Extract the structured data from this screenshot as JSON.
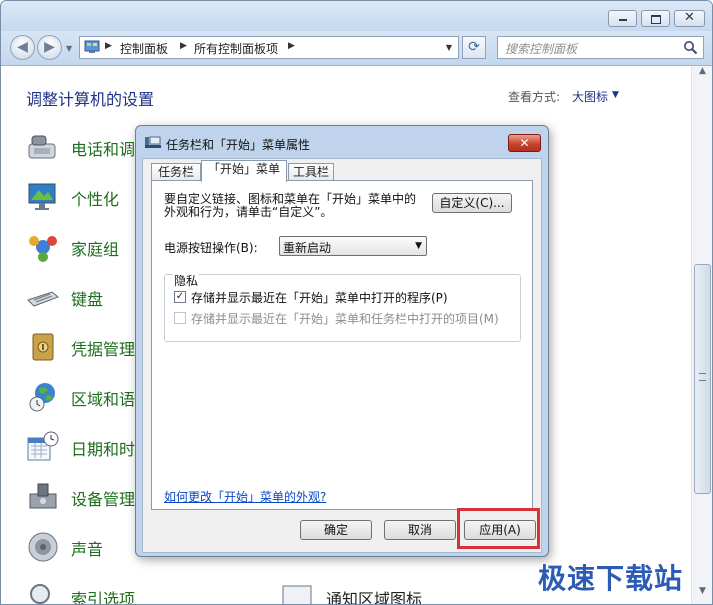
{
  "window": {
    "caption_buttons": {
      "minimize": "",
      "maximize": "",
      "close": "✕"
    }
  },
  "address_bar": {
    "crumbs": [
      "控制面板",
      "所有控制面板项"
    ],
    "search_placeholder": "搜索控制面板"
  },
  "content": {
    "title": "调整计算机的设置",
    "view_by_label": "查看方式:",
    "view_by_value": "大图标",
    "items": [
      {
        "label": "电话和调",
        "icon": "phone-modem-icon"
      },
      {
        "label": "个性化",
        "icon": "personalization-icon"
      },
      {
        "label": "家庭组",
        "icon": "homegroup-icon"
      },
      {
        "label": "键盘",
        "icon": "keyboard-icon"
      },
      {
        "label": "凭据管理",
        "icon": "credential-manager-icon"
      },
      {
        "label": "区域和语",
        "icon": "region-globe-icon"
      },
      {
        "label": "日期和时",
        "icon": "calendar-clock-icon"
      },
      {
        "label": "设备管理",
        "icon": "device-manager-icon"
      },
      {
        "label": "声音",
        "icon": "speaker-icon"
      },
      {
        "label": "索引选项",
        "icon": "indexing-icon"
      }
    ],
    "right_column_partial": {
      "label": "通知区域图标"
    }
  },
  "dialog": {
    "title": "任务栏和「开始」菜单属性",
    "close_label": "✕",
    "tabs": [
      "任务栏",
      "「开始」菜单",
      "工具栏"
    ],
    "active_tab": 1,
    "description_line1": "要自定义链接、图标和菜单在「开始」菜单中的",
    "description_line2": "外观和行为，请单击“自定义”。",
    "customize_button": "自定义(C)...",
    "power_label": "电源按钮操作(B):",
    "power_value": "重新启动",
    "privacy_group": "隐私",
    "checkbox1": {
      "label": "存储并显示最近在「开始」菜单中打开的程序(P)",
      "checked": true,
      "enabled": true
    },
    "checkbox2": {
      "label": "存储并显示最近在「开始」菜单和任务栏中打开的项目(M)",
      "checked": false,
      "enabled": false
    },
    "help_link": "如何更改「开始」菜单的外观?",
    "buttons": {
      "ok": "确定",
      "cancel": "取消",
      "apply": "应用(A)"
    }
  },
  "colors": {
    "link_green": "#1e6e1e",
    "title_blue": "#1e3287",
    "highlight_red": "#d6323a",
    "dialog_frame": "#bfd4ec"
  },
  "watermark": "极速下载站"
}
